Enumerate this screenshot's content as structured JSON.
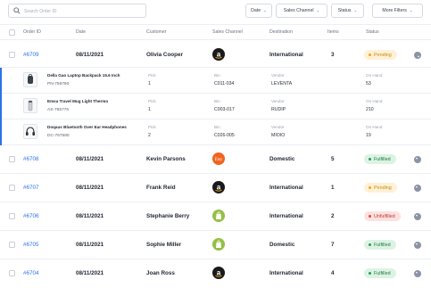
{
  "toolbar": {
    "search_placeholder": "Search Order ID",
    "filters": [
      {
        "label": "Date"
      },
      {
        "label": "Sales Channel"
      },
      {
        "label": "Status"
      }
    ],
    "more_filters": "More Filters"
  },
  "columns": [
    "Order ID",
    "Date",
    "Customer",
    "Sales Channel",
    "Destination",
    "Items",
    "Status"
  ],
  "orders": [
    {
      "id": "#6709",
      "date": "08/11/2021",
      "customer": "Olivia Cooper",
      "channel": "amazon",
      "destination": "International",
      "items": "3",
      "status": "Pending"
    },
    {
      "id": "#6708",
      "date": "08/11/2021",
      "customer": "Kevin Parsons",
      "channel": "etsy",
      "destination": "Domestic",
      "items": "5",
      "status": "Fulfilled"
    },
    {
      "id": "#6707",
      "date": "08/11/2021",
      "customer": "Frank Reid",
      "channel": "amazon",
      "destination": "International",
      "items": "1",
      "status": "Pending"
    },
    {
      "id": "#6706",
      "date": "08/11/2021",
      "customer": "Stephanie Berry",
      "channel": "shopify",
      "destination": "International",
      "items": "2",
      "status": "Unfulfilled"
    },
    {
      "id": "#6705",
      "date": "08/11/2021",
      "customer": "Sophie Miller",
      "channel": "shopify",
      "destination": "Domestic",
      "items": "7",
      "status": "Fulfilled"
    },
    {
      "id": "#6704",
      "date": "08/11/2021",
      "customer": "Joan Ross",
      "channel": "amazon",
      "destination": "International",
      "items": "4",
      "status": "Fulfilled"
    }
  ],
  "channel_logos": {
    "etsy": "Etsy"
  },
  "sub_labels": {
    "pick": "Pick",
    "bin": "Bin",
    "vendor": "Vendor",
    "on_hand": "On Hand"
  },
  "line_items": [
    {
      "name": "Della Gao Laptop Backpack 15.6 Inch",
      "sku": "PN-756760",
      "pick": "1",
      "bin": "C011-034",
      "vendor": "LEVENTA",
      "on_hand": "53",
      "icon": "backpack-icon"
    },
    {
      "name": "Emsa Travel Mug Light Thermo",
      "sku": "AS-765776",
      "pick": "1",
      "bin": "C003-017",
      "vendor": "RUDIP",
      "on_hand": "210",
      "icon": "mug-icon"
    },
    {
      "name": "Doqaus Bluetooth Over Ear Headphones",
      "sku": "DC-767580",
      "pick": "2",
      "bin": "C026-005",
      "vendor": "MIOIO",
      "on_hand": "19",
      "icon": "headphones-icon"
    }
  ],
  "colors": {
    "link": "#2a73e8",
    "pending": "#f0a419",
    "fulfilled": "#2a9d55",
    "unfulfilled": "#e0453a",
    "amazon": "#1a1a1a",
    "etsy": "#f1641e",
    "shopify": "#95bf47"
  }
}
